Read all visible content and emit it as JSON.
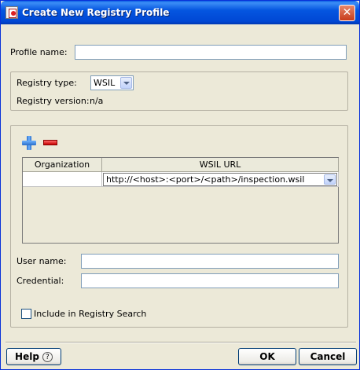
{
  "window": {
    "title": "Create New Registry Profile",
    "close_glyph": "✕"
  },
  "profile": {
    "name_label": "Profile name:",
    "name_value": ""
  },
  "registry": {
    "type_label": "Registry type:",
    "type_value": "WSIL",
    "version_label": "Registry version:",
    "version_value": "n/a"
  },
  "table": {
    "columns": [
      "Organization",
      "WSIL URL"
    ],
    "rows": [
      {
        "organization": "",
        "wsil_url": "http://<host>:<port>/<path>/inspection.wsil"
      }
    ]
  },
  "credentials": {
    "user_label": "User name:",
    "user_value": "",
    "credential_label": "Credential:",
    "credential_value": ""
  },
  "include": {
    "label": "Include in Registry Search",
    "checked": false
  },
  "buttons": {
    "help": "Help",
    "help_glyph": "?",
    "ok": "OK",
    "cancel": "Cancel"
  },
  "icons": {
    "add": "add-icon",
    "remove": "remove-icon",
    "app": "registry-app-icon"
  }
}
